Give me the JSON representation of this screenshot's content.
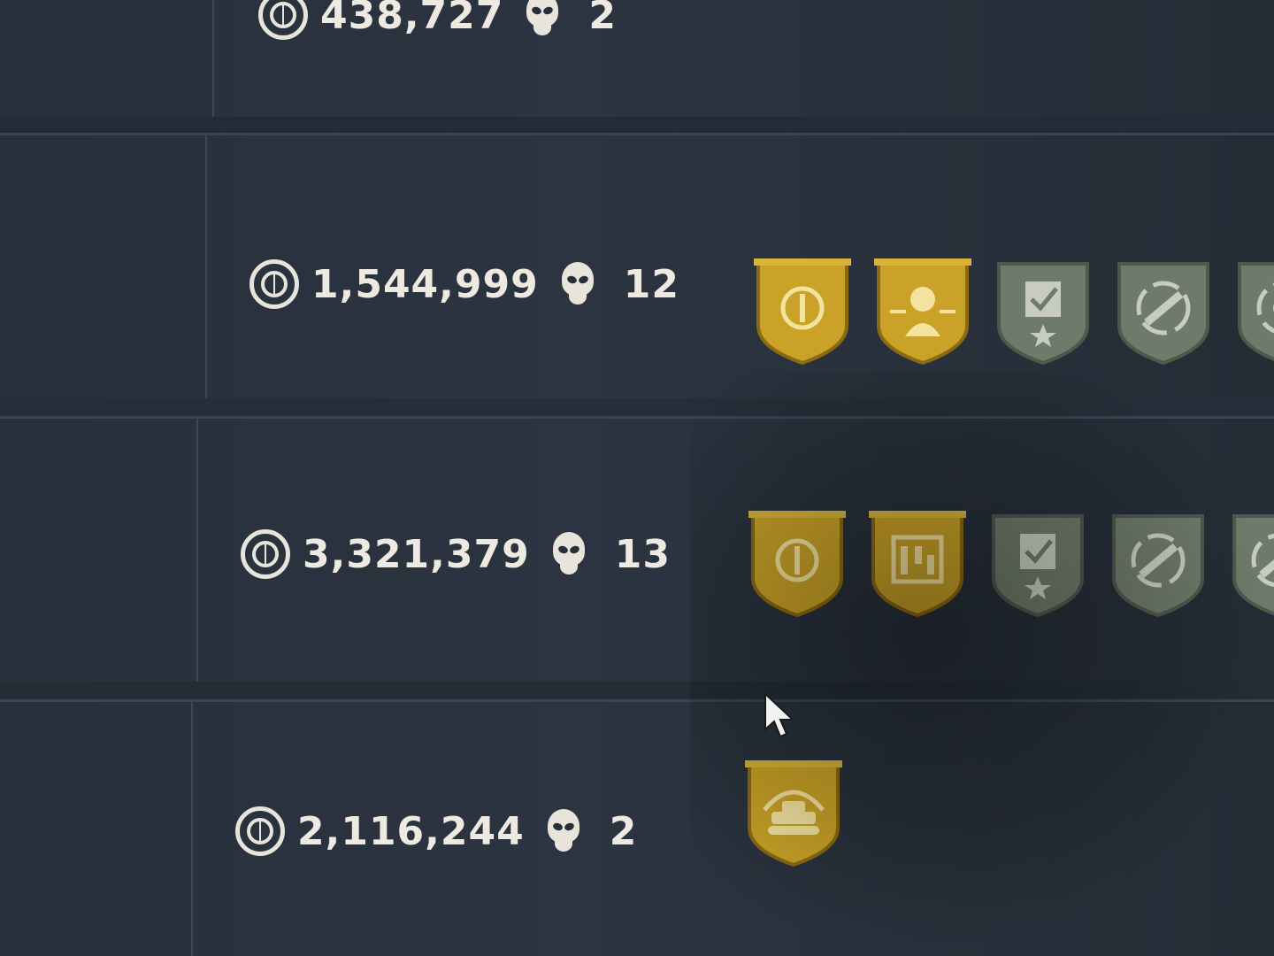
{
  "rows": [
    {
      "credits": "438,727",
      "kills": "2",
      "badges": []
    },
    {
      "credits": "1,544,999",
      "kills": "12",
      "badges": [
        "gold-credits-medal-icon",
        "gold-soldier-medal-icon",
        "gray-checklist-medal-icon",
        "gray-repair-medal-icon",
        "gray-target-medal-icon"
      ]
    },
    {
      "credits": "3,321,379",
      "kills": "13",
      "badges": [
        "gold-credits-medal-icon",
        "gold-building-medal-icon",
        "gray-checklist-medal-icon",
        "gray-repair-medal-icon",
        "gray-repair-medal-icon"
      ]
    },
    {
      "credits": "2,116,244",
      "kills": "2",
      "badges": [
        "gold-tank-medal-icon"
      ]
    }
  ],
  "colors": {
    "gold": "#c9a227",
    "gold_dark": "#8a6a12",
    "gray": "#6e7a6a",
    "text": "#eeeae2",
    "background": "#262e39"
  }
}
